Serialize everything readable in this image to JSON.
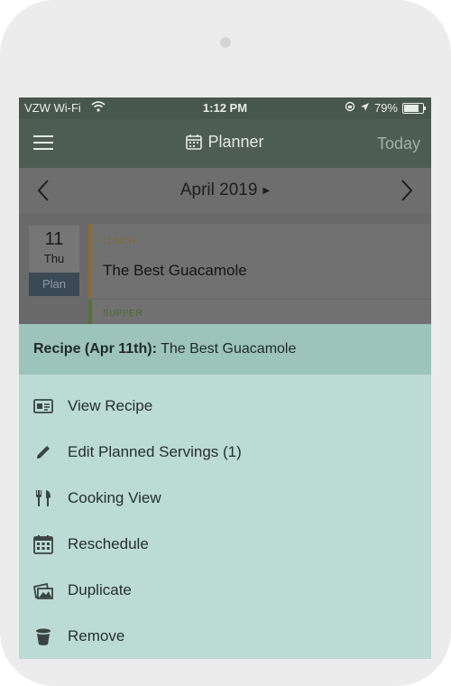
{
  "status_bar": {
    "carrier": "VZW Wi-Fi",
    "time": "1:12 PM",
    "battery": "79%"
  },
  "header": {
    "title": "Planner",
    "today_label": "Today"
  },
  "month_nav": {
    "month": "April 2019"
  },
  "day": {
    "date_number": "11",
    "weekday": "Thu",
    "plan_label": "Plan"
  },
  "meals": [
    {
      "type": "LUNCH",
      "name": "The Best Guacamole"
    },
    {
      "type": "SUPPER",
      "name": ""
    }
  ],
  "sheet": {
    "title_prefix": "Recipe (Apr 11th):",
    "title_recipe": " The Best Guacamole",
    "actions": [
      {
        "label": "View Recipe",
        "icon": "recipe-card-icon"
      },
      {
        "label": "Edit Planned Servings (1)",
        "icon": "pencil-icon"
      },
      {
        "label": "Cooking View",
        "icon": "utensils-icon"
      },
      {
        "label": "Reschedule",
        "icon": "calendar-icon"
      },
      {
        "label": "Duplicate",
        "icon": "duplicate-icon"
      },
      {
        "label": "Remove",
        "icon": "trash-icon"
      }
    ]
  },
  "colors": {
    "sheet_bg": "#bbdbd4",
    "sheet_header_bg": "#9cc4bb",
    "lunch_accent": "#8b6f2e",
    "supper_accent": "#557237"
  }
}
